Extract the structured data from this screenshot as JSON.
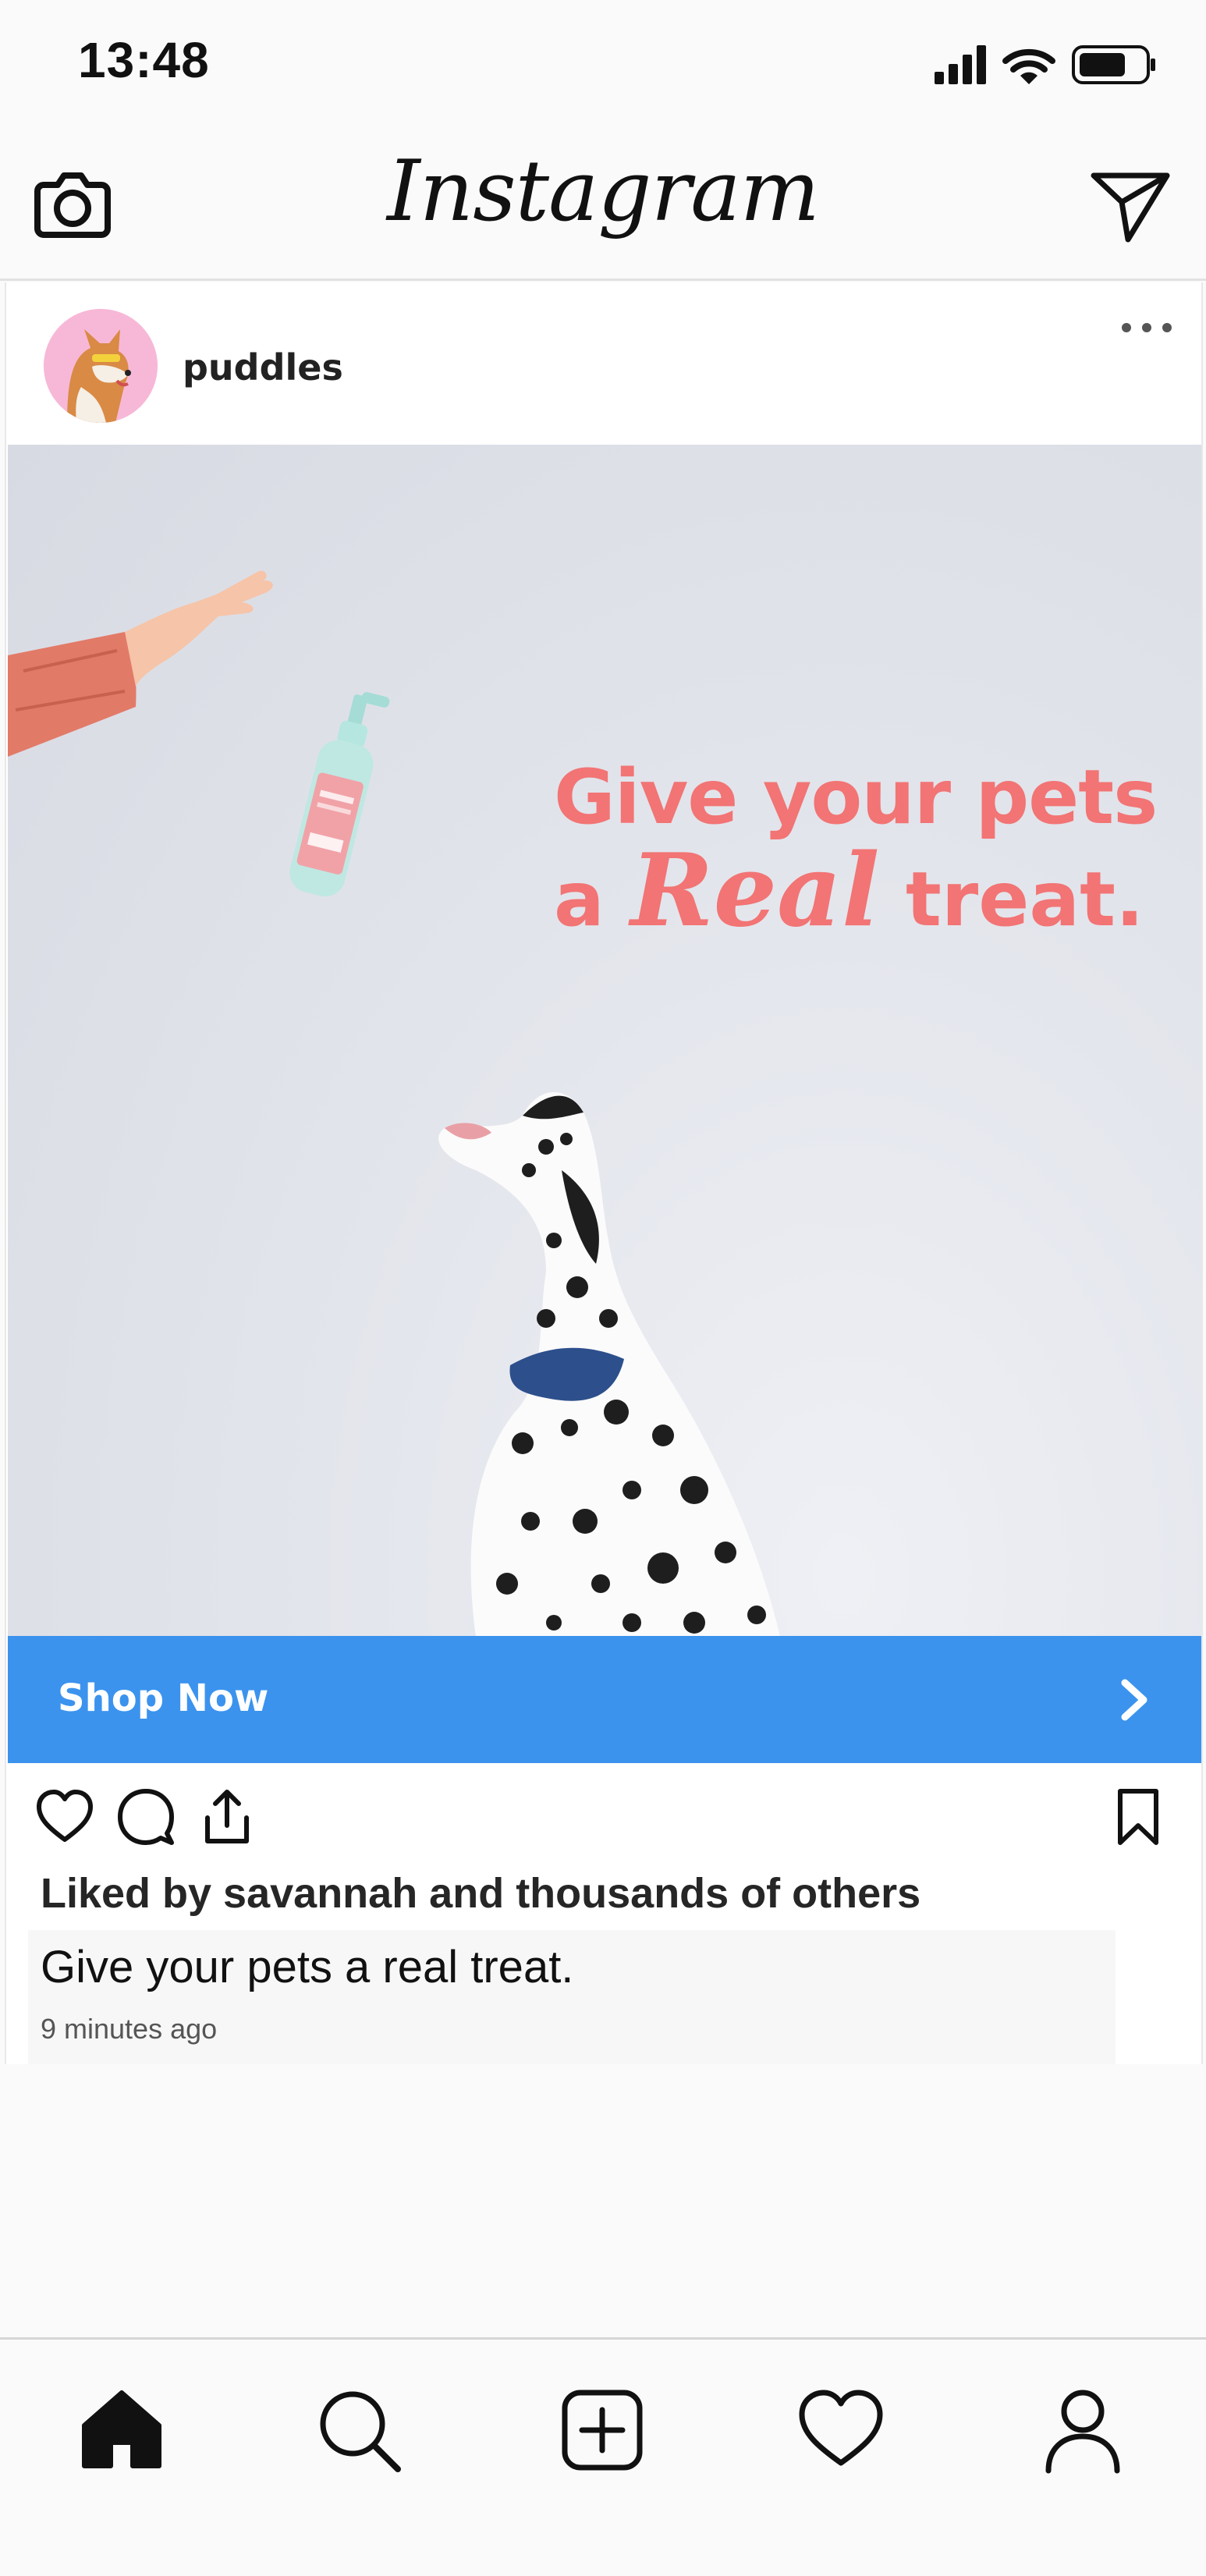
{
  "status_bar": {
    "time": "13:48",
    "icons": [
      "signal-icon",
      "wifi-icon",
      "battery-icon"
    ]
  },
  "header": {
    "logo_text": "Instagram",
    "left_icon": "camera-icon",
    "right_icon": "direct-message-icon"
  },
  "post": {
    "username": "puddles",
    "avatar_icon": "shiba-dog-avatar",
    "more_icon": "more-options-icon",
    "image": {
      "headline_line1": "Give your pets",
      "headline_line2_prefix": "a",
      "headline_line2_script": "Real",
      "headline_line2_suffix": "treat.",
      "accent_color": "#f27474"
    },
    "cta": {
      "label": "Shop Now",
      "color": "#3b93ee"
    },
    "actions": {
      "left": [
        "heart-icon",
        "comment-icon",
        "share-icon"
      ],
      "right": "bookmark-icon"
    },
    "likes_text": "Liked by savannah and thousands of others",
    "caption": "Give your pets a real treat.",
    "timestamp": "9 minutes ago"
  },
  "bottom_nav": {
    "items": [
      "home-icon",
      "search-icon",
      "new-post-icon",
      "activity-icon",
      "profile-icon"
    ],
    "active": "home-icon"
  }
}
